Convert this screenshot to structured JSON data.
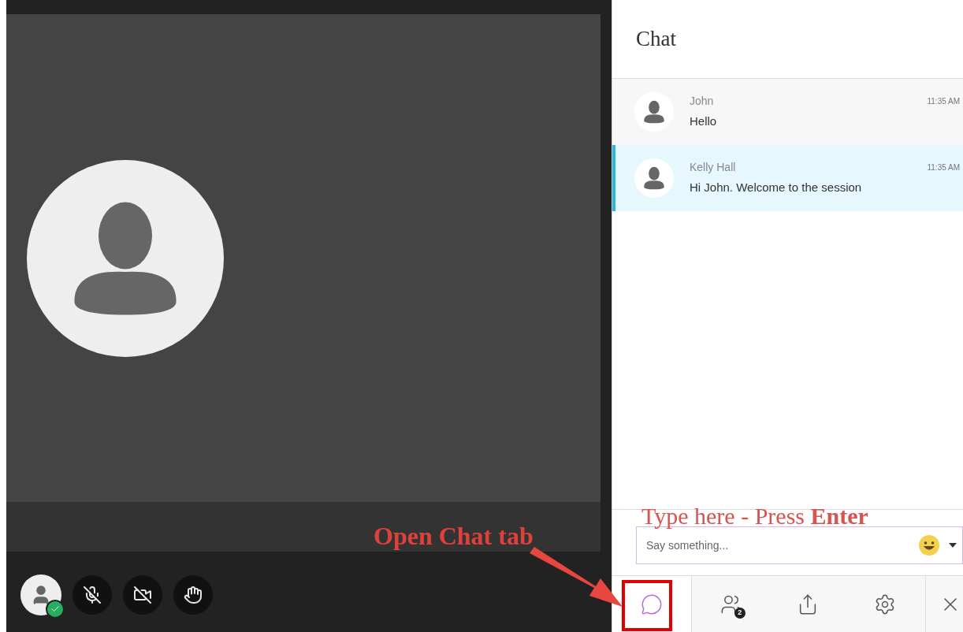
{
  "stage": {
    "controls": [
      {
        "kind": "avatar",
        "online": true
      },
      {
        "kind": "microphone",
        "on": false
      },
      {
        "kind": "camera",
        "on": false
      },
      {
        "kind": "hand",
        "on": false
      }
    ]
  },
  "chat": {
    "title": "Chat",
    "messages": [
      {
        "author": "John",
        "time": "11:35 AM",
        "text": "Hello",
        "selected": false
      },
      {
        "author": "Kelly Hall",
        "time": "11:35 AM",
        "text": "Hi John. Welcome to the session",
        "selected": true
      }
    ],
    "input": {
      "placeholder": "Say something..."
    },
    "tabs": [
      {
        "kind": "chat",
        "selected": true
      },
      {
        "kind": "people",
        "selected": false,
        "badge": "2"
      },
      {
        "kind": "share",
        "selected": false
      },
      {
        "kind": "settings",
        "selected": false
      },
      {
        "kind": "close",
        "selected": false
      }
    ]
  },
  "annotations": [
    {
      "kind": "tab-callout",
      "text": "Open Chat tab"
    },
    {
      "kind": "input-callout",
      "text": "Type here - Press **Enter**"
    }
  ]
}
